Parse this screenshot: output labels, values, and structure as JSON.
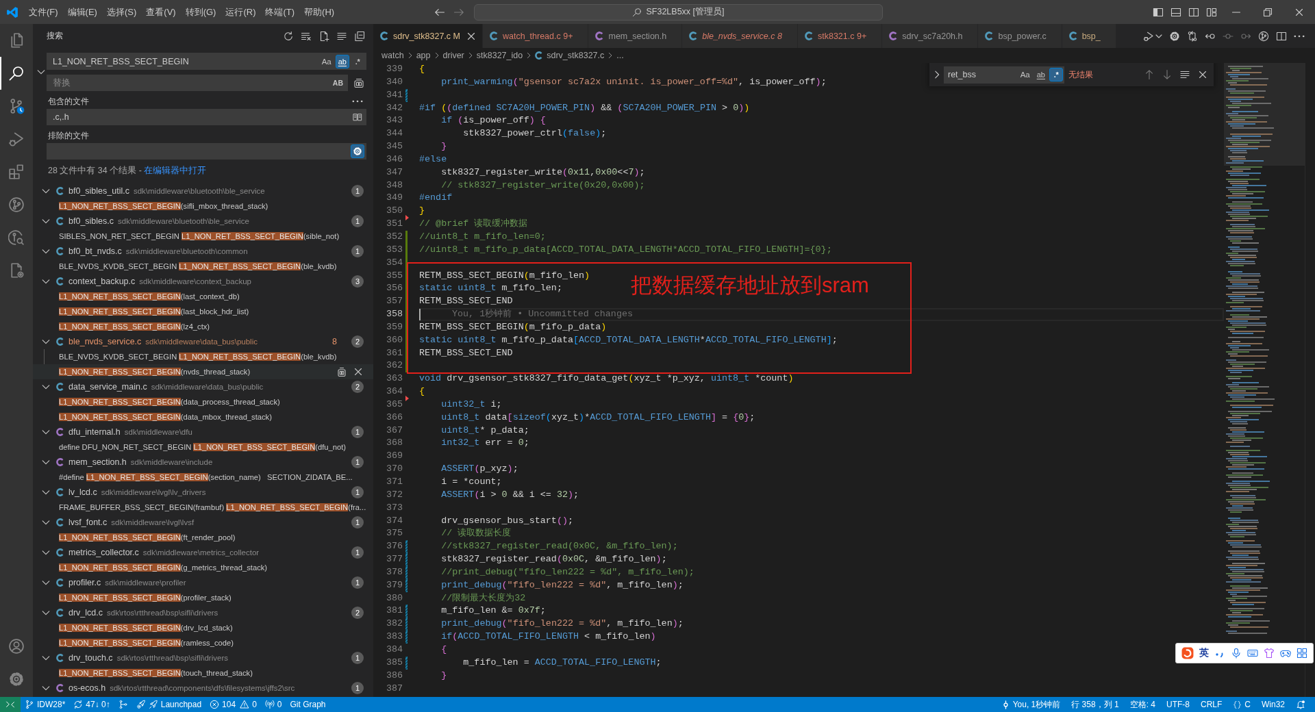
{
  "title_bar": {
    "menu": [
      "文件(F)",
      "编辑(E)",
      "选择(S)",
      "查看(V)",
      "转到(G)",
      "运行(R)",
      "终端(T)",
      "帮助(H)"
    ],
    "command_center": "SF32LB5xx [管理员]"
  },
  "activity_bar": {
    "top": [
      {
        "kind": "explorer",
        "selected": false
      },
      {
        "kind": "search",
        "selected": true
      },
      {
        "kind": "scm",
        "selected": false
      },
      {
        "kind": "debug",
        "selected": false
      },
      {
        "kind": "extensions",
        "selected": false
      },
      {
        "kind": "graph",
        "selected": false
      },
      {
        "kind": "inspect",
        "selected": false
      },
      {
        "kind": "config",
        "selected": false
      }
    ],
    "bottom": [
      {
        "kind": "accounts"
      },
      {
        "kind": "manage"
      }
    ]
  },
  "search_view": {
    "title": "搜索",
    "query": {
      "value": "L1_NON_RET_BSS_SECT_BEGIN",
      "options": [
        {
          "label": "Aa",
          "kind": "case",
          "on": false
        },
        {
          "label": "ab",
          "kind": "word",
          "on": true
        },
        {
          "label": ".*",
          "kind": "regex",
          "on": false
        }
      ]
    },
    "replace_expanded": true,
    "replace": {
      "placeholder": "替换",
      "options": [
        {
          "label": "AB",
          "kind": "preserve",
          "on": false
        }
      ]
    },
    "include": {
      "label": "包含的文件",
      "value": ".c,.h",
      "open_editors_only": false
    },
    "exclude": {
      "label": "排除的文件",
      "use_settings": true
    },
    "summary": "28 文件中有 34 个结果 -",
    "open_in_editor": "在编辑器中打开",
    "results": [
      {
        "file": "bf0_sibles_util.c",
        "kind": "source",
        "path": "sdk\\middleware\\bluetooth\\ble_service",
        "count": "1",
        "expanded": true,
        "matches": [
          {
            "match": "L1_NON_RET_BSS_SECT_BEGIN",
            "after": "(sifli_mbox_thread_stack)",
            "hovered": false
          }
        ]
      },
      {
        "file": "bf0_sibles.c",
        "kind": "source",
        "path": "sdk\\middleware\\bluetooth\\ble_service",
        "count": "1",
        "expanded": true,
        "matches": [
          {
            "before": "SIBLES_NON_RET_SECT_BEGIN ",
            "match": "L1_NON_RET_BSS_SECT_BEGIN",
            "after": "(sible_not)",
            "hovered": false
          }
        ]
      },
      {
        "file": "bf0_bt_nvds.c",
        "kind": "source",
        "path": "sdk\\middleware\\bluetooth\\common",
        "count": "1",
        "expanded": true,
        "matches": [
          {
            "before": "BLE_NVDS_KVDB_SECT_BEGIN ",
            "match": "L1_NON_RET_BSS_SECT_BEGIN",
            "after": "(ble_kvdb)",
            "hovered": false
          }
        ]
      },
      {
        "file": "context_backup.c",
        "kind": "source",
        "path": "sdk\\middleware\\context_backup",
        "count": "3",
        "expanded": true,
        "matches": [
          {
            "match": "L1_NON_RET_BSS_SECT_BEGIN",
            "after": "(last_context_db)",
            "hovered": false
          },
          {
            "match": "L1_NON_RET_BSS_SECT_BEGIN",
            "after": "(last_block_hdr_list)",
            "hovered": false
          },
          {
            "match": "L1_NON_RET_BSS_SECT_BEGIN",
            "after": "(lz4_ctx)",
            "hovered": false
          }
        ]
      },
      {
        "file": "ble_nvds_service.c",
        "kind": "source",
        "path": "sdk\\middleware\\data_bus\\public",
        "problems": "8",
        "count": "2",
        "expanded": true,
        "matches": [
          {
            "before": "BLE_NVDS_KVDB_SECT_BEGIN ",
            "match": "L1_NON_RET_BSS_SECT_BEGIN",
            "after": "(ble_kvdb)",
            "hovered": false
          },
          {
            "match": "L1_NON_RET_BSS_SECT_BEGIN",
            "after": "(nvds_thread_stack)",
            "hovered": true
          }
        ]
      },
      {
        "file": "data_service_main.c",
        "kind": "source",
        "path": "sdk\\middleware\\data_bus\\public",
        "count": "2",
        "expanded": true,
        "matches": [
          {
            "match": "L1_NON_RET_BSS_SECT_BEGIN",
            "after": "(data_process_thread_stack)",
            "hovered": false
          },
          {
            "match": "L1_NON_RET_BSS_SECT_BEGIN",
            "after": "(data_mbox_thread_stack)",
            "hovered": false
          }
        ]
      },
      {
        "file": "dfu_internal.h",
        "kind": "header",
        "path": "sdk\\middleware\\dfu",
        "count": "1",
        "expanded": true,
        "matches": [
          {
            "before": "define DFU_NON_RET_SECT_BEGIN ",
            "match": "L1_NON_RET_BSS_SECT_BEGIN",
            "after": "(dfu_not)",
            "hovered": false
          }
        ]
      },
      {
        "file": "mem_section.h",
        "kind": "header",
        "path": "sdk\\middleware\\include",
        "count": "1",
        "expanded": true,
        "matches": [
          {
            "before": "#define ",
            "match": "L1_NON_RET_BSS_SECT_BEGIN",
            "after": "(section_name)   SECTION_ZIDATA_BE...",
            "hovered": false
          }
        ]
      },
      {
        "file": "lv_lcd.c",
        "kind": "source",
        "path": "sdk\\middleware\\lvgl\\lv_drivers",
        "count": "1",
        "expanded": true,
        "matches": [
          {
            "before": "FRAME_BUFFER_BSS_SECT_BEGIN(frambuf) ",
            "match": "L1_NON_RET_BSS_SECT_BEGIN",
            "after": "(fra...",
            "hovered": false
          }
        ]
      },
      {
        "file": "lvsf_font.c",
        "kind": "source",
        "path": "sdk\\middleware\\lvgl\\lvsf",
        "count": "1",
        "expanded": true,
        "matches": [
          {
            "match": "L1_NON_RET_BSS_SECT_BEGIN",
            "after": "(ft_render_pool)",
            "hovered": false
          }
        ]
      },
      {
        "file": "metrics_collector.c",
        "kind": "source",
        "path": "sdk\\middleware\\metrics_collector",
        "count": "1",
        "expanded": true,
        "matches": [
          {
            "match": "L1_NON_RET_BSS_SECT_BEGIN",
            "after": "(g_metrics_thread_stack)",
            "hovered": false
          }
        ]
      },
      {
        "file": "profiler.c",
        "kind": "source",
        "path": "sdk\\middleware\\profiler",
        "count": "1",
        "expanded": true,
        "matches": [
          {
            "match": "L1_NON_RET_BSS_SECT_BEGIN",
            "after": "(profiler_stack)",
            "hovered": false
          }
        ]
      },
      {
        "file": "drv_lcd.c",
        "kind": "source",
        "path": "sdk\\rtos\\rtthread\\bsp\\sifli\\drivers",
        "count": "2",
        "expanded": true,
        "matches": [
          {
            "match": "L1_NON_RET_BSS_SECT_BEGIN",
            "after": "(drv_lcd_stack)",
            "hovered": false
          },
          {
            "match": "L1_NON_RET_BSS_SECT_BEGIN",
            "after": "(ramless_code)",
            "hovered": false
          }
        ]
      },
      {
        "file": "drv_touch.c",
        "kind": "source",
        "path": "sdk\\rtos\\rtthread\\bsp\\sifli\\drivers",
        "count": "1",
        "expanded": true,
        "matches": [
          {
            "match": "L1_NON_RET_BSS_SECT_BEGIN",
            "after": "(touch_thread_stack)",
            "hovered": false
          }
        ]
      },
      {
        "file": "os-ecos.h",
        "kind": "header",
        "path": "sdk\\rtos\\rtthread\\components\\dfs\\filesystems\\jffs2\\src",
        "count": "1",
        "expanded": true
      }
    ]
  },
  "editor": {
    "tabs": [
      {
        "file": "sdrv_stk8327.c",
        "kind": "source",
        "badge": "M",
        "modified": true,
        "has_errors": false,
        "preview": false,
        "selected": true
      },
      {
        "file": "watch_thread.c",
        "kind": "source",
        "badge": "9+",
        "has_errors": true,
        "preview": false,
        "selected": false
      },
      {
        "file": "mem_section.h",
        "kind": "header",
        "modified": false,
        "has_errors": false,
        "preview": false,
        "selected": false
      },
      {
        "file": "ble_nvds_service.c",
        "kind": "source",
        "badge": "8",
        "has_errors": true,
        "preview": true,
        "selected": false
      },
      {
        "file": "stk8321.c",
        "kind": "source",
        "badge": "9+",
        "has_errors": true,
        "preview": false,
        "selected": false
      },
      {
        "file": "sdrv_sc7a20h.h",
        "kind": "header",
        "modified": false,
        "has_errors": false,
        "preview": false,
        "selected": false
      },
      {
        "file": "bsp_power.c",
        "kind": "source",
        "modified": false,
        "has_errors": false,
        "preview": false,
        "selected": false
      },
      {
        "file": "bsp_",
        "kind": "source",
        "modified": true,
        "has_errors": false,
        "preview": false,
        "selected": false
      }
    ],
    "breadcrumbs": [
      {
        "label": "watch",
        "kind": "folder"
      },
      {
        "label": "app",
        "kind": "folder"
      },
      {
        "label": "driver",
        "kind": "folder"
      },
      {
        "label": "stk8327_ido",
        "kind": "folder"
      },
      {
        "label": "sdrv_stk8327.c",
        "kind": "source"
      },
      {
        "label": "...",
        "kind": "symbol"
      }
    ],
    "lines": [
      {
        "number": "339",
        "kind": "unchanged",
        "current": false,
        "tokens": [
          {
            "text": "{",
            "kind": "bracket1"
          }
        ]
      },
      {
        "number": "340",
        "kind": "unchanged",
        "current": false,
        "tokens": [
          {
            "text": "    print_warming",
            "kind": "macro"
          },
          {
            "text": "(",
            "kind": "bracket2"
          },
          {
            "text": "\"gsensor sc7a2x uninit. is_power_off=%d\"",
            "kind": "string"
          },
          {
            "text": ", is_power_off",
            "kind": "plain"
          },
          {
            "text": ")",
            "kind": "bracket2"
          },
          {
            "text": ";",
            "kind": "plain"
          }
        ]
      },
      {
        "number": "341",
        "kind": "modified",
        "current": false
      },
      {
        "number": "342",
        "kind": "unchanged",
        "current": false,
        "tokens": [
          {
            "text": "#if ",
            "kind": "keyword"
          },
          {
            "text": "(",
            "kind": "bracket1"
          },
          {
            "text": "(",
            "kind": "bracket2"
          },
          {
            "text": "defined ",
            "kind": "keyword"
          },
          {
            "text": "SC7A20H_POWER_PIN",
            "kind": "macro"
          },
          {
            "text": ")",
            "kind": "bracket2"
          },
          {
            "text": " && ",
            "kind": "plain"
          },
          {
            "text": "(",
            "kind": "bracket2"
          },
          {
            "text": "SC7A20H_POWER_PIN",
            "kind": "macro"
          },
          {
            "text": " > ",
            "kind": "plain"
          },
          {
            "text": "0",
            "kind": "number"
          },
          {
            "text": ")",
            "kind": "bracket2"
          },
          {
            "text": ")",
            "kind": "bracket1"
          }
        ]
      },
      {
        "number": "343",
        "kind": "unchanged",
        "current": false,
        "tokens": [
          {
            "text": "    if ",
            "kind": "keyword"
          },
          {
            "text": "(",
            "kind": "bracket2"
          },
          {
            "text": "is_power_off",
            "kind": "plain"
          },
          {
            "text": ")",
            "kind": "bracket2"
          },
          {
            "text": " {",
            "kind": "bracket2"
          }
        ]
      },
      {
        "number": "344",
        "kind": "unchanged",
        "current": false,
        "tokens": [
          {
            "text": "        stk8327_power_ctrl",
            "kind": "plain"
          },
          {
            "text": "(",
            "kind": "bracket3"
          },
          {
            "text": "false",
            "kind": "keyword"
          },
          {
            "text": ")",
            "kind": "bracket3"
          },
          {
            "text": ";",
            "kind": "plain"
          }
        ]
      },
      {
        "number": "345",
        "kind": "unchanged",
        "current": false,
        "tokens": [
          {
            "text": "    }",
            "kind": "bracket2"
          }
        ]
      },
      {
        "number": "346",
        "kind": "unchanged",
        "current": false,
        "tokens": [
          {
            "text": "#else",
            "kind": "keyword"
          }
        ]
      },
      {
        "number": "347",
        "kind": "unchanged",
        "current": false,
        "tokens": [
          {
            "text": "    stk8327_register_write",
            "kind": "plain"
          },
          {
            "text": "(",
            "kind": "bracket2"
          },
          {
            "text": "0x11",
            "kind": "number"
          },
          {
            "text": ",",
            "kind": "plain"
          },
          {
            "text": "0x00",
            "kind": "number"
          },
          {
            "text": "<<",
            "kind": "plain"
          },
          {
            "text": "7",
            "kind": "number"
          },
          {
            "text": ")",
            "kind": "bracket2"
          },
          {
            "text": ";",
            "kind": "plain"
          }
        ]
      },
      {
        "number": "348",
        "kind": "unchanged",
        "current": false,
        "tokens": [
          {
            "text": "    // stk8327_register_write(0x20,0x00);",
            "kind": "comment"
          }
        ]
      },
      {
        "number": "349",
        "kind": "unchanged",
        "current": false,
        "tokens": [
          {
            "text": "#endif",
            "kind": "keyword"
          }
        ]
      },
      {
        "number": "350",
        "kind": "deleted",
        "current": false,
        "tokens": [
          {
            "text": "}",
            "kind": "bracket1"
          }
        ]
      },
      {
        "number": "351",
        "kind": "unchanged",
        "current": false,
        "tokens": [
          {
            "text": "// @brief 读取缓冲数据",
            "kind": "comment"
          }
        ]
      },
      {
        "number": "352",
        "kind": "added",
        "current": false,
        "tokens": [
          {
            "text": "//uint8_t m_fifo_len=0;",
            "kind": "comment"
          }
        ]
      },
      {
        "number": "353",
        "kind": "added",
        "current": false,
        "tokens": [
          {
            "text": "//uint8_t m_fifo_p_data[ACCD_TOTAL_DATA_LENGTH*ACCD_TOTAL_FIFO_LENGTH]={0};",
            "kind": "comment"
          }
        ]
      },
      {
        "number": "354",
        "kind": "added",
        "current": false
      },
      {
        "number": "355",
        "kind": "added",
        "current": false,
        "tokens": [
          {
            "text": "RETM_BSS_SECT_BEGIN",
            "kind": "plain"
          },
          {
            "text": "(",
            "kind": "bracket1"
          },
          {
            "text": "m_fifo_len",
            "kind": "plain"
          },
          {
            "text": ")",
            "kind": "bracket1"
          }
        ]
      },
      {
        "number": "356",
        "kind": "added",
        "current": false,
        "tokens": [
          {
            "text": "static uint8_t",
            "kind": "keyword"
          },
          {
            "text": " m_fifo_len;",
            "kind": "plain"
          }
        ]
      },
      {
        "number": "357",
        "kind": "added",
        "current": false,
        "tokens": [
          {
            "text": "RETM_BSS_SECT_END",
            "kind": "plain"
          }
        ]
      },
      {
        "number": "358",
        "kind": "added",
        "current": true,
        "blame": "You, 1秒钟前 • Uncommitted changes"
      },
      {
        "number": "359",
        "kind": "added",
        "current": false,
        "tokens": [
          {
            "text": "RETM_BSS_SECT_BEGIN",
            "kind": "plain"
          },
          {
            "text": "(",
            "kind": "bracket1"
          },
          {
            "text": "m_fifo_p_data",
            "kind": "plain"
          },
          {
            "text": ")",
            "kind": "bracket1"
          }
        ]
      },
      {
        "number": "360",
        "kind": "added",
        "current": false,
        "tokens": [
          {
            "text": "static uint8_t",
            "kind": "keyword"
          },
          {
            "text": " m_fifo_p_data",
            "kind": "plain"
          },
          {
            "text": "[",
            "kind": "bracket3"
          },
          {
            "text": "ACCD_TOTAL_DATA_LENGTH",
            "kind": "macro"
          },
          {
            "text": "*",
            "kind": "plain"
          },
          {
            "text": "ACCD_TOTAL_FIFO_LENGTH",
            "kind": "macro"
          },
          {
            "text": "]",
            "kind": "bracket3"
          },
          {
            "text": ";",
            "kind": "plain"
          }
        ]
      },
      {
        "number": "361",
        "kind": "added",
        "current": false,
        "tokens": [
          {
            "text": "RETM_BSS_SECT_END",
            "kind": "plain"
          }
        ]
      },
      {
        "number": "362",
        "kind": "added",
        "current": false
      },
      {
        "number": "363",
        "kind": "unchanged",
        "current": false,
        "tokens": [
          {
            "text": "void",
            "kind": "keyword"
          },
          {
            "text": " drv_gsensor_stk8327_fifo_data_get",
            "kind": "plain"
          },
          {
            "text": "(",
            "kind": "bracket1"
          },
          {
            "text": "xyz_t *p_xyz, ",
            "kind": "plain"
          },
          {
            "text": "uint8_t",
            "kind": "keyword"
          },
          {
            "text": " *count",
            "kind": "plain"
          },
          {
            "text": ")",
            "kind": "bracket1"
          }
        ]
      },
      {
        "number": "364",
        "kind": "deleted",
        "current": false,
        "tokens": [
          {
            "text": "{",
            "kind": "bracket1"
          }
        ]
      },
      {
        "number": "365",
        "kind": "unchanged",
        "current": false,
        "tokens": [
          {
            "text": "    uint32_t",
            "kind": "keyword"
          },
          {
            "text": " i;",
            "kind": "plain"
          }
        ]
      },
      {
        "number": "366",
        "kind": "unchanged",
        "current": false,
        "tokens": [
          {
            "text": "    uint8_t",
            "kind": "keyword"
          },
          {
            "text": " data",
            "kind": "plain"
          },
          {
            "text": "[",
            "kind": "bracket2"
          },
          {
            "text": "sizeof",
            "kind": "keyword"
          },
          {
            "text": "(",
            "kind": "bracket3"
          },
          {
            "text": "xyz_t",
            "kind": "plain"
          },
          {
            "text": ")",
            "kind": "bracket3"
          },
          {
            "text": "*",
            "kind": "plain"
          },
          {
            "text": "ACCD_TOTAL_FIFO_LENGTH",
            "kind": "macro"
          },
          {
            "text": "]",
            "kind": "bracket2"
          },
          {
            "text": " = ",
            "kind": "plain"
          },
          {
            "text": "{",
            "kind": "bracket2"
          },
          {
            "text": "0",
            "kind": "number"
          },
          {
            "text": "}",
            "kind": "bracket2"
          },
          {
            "text": ";",
            "kind": "plain"
          }
        ]
      },
      {
        "number": "367",
        "kind": "unchanged",
        "current": false,
        "tokens": [
          {
            "text": "    uint8_t",
            "kind": "keyword"
          },
          {
            "text": "* p_data;",
            "kind": "plain"
          }
        ]
      },
      {
        "number": "368",
        "kind": "unchanged",
        "current": false,
        "tokens": [
          {
            "text": "    int32_t",
            "kind": "keyword"
          },
          {
            "text": " err = ",
            "kind": "plain"
          },
          {
            "text": "0",
            "kind": "number"
          },
          {
            "text": ";",
            "kind": "plain"
          }
        ]
      },
      {
        "number": "369",
        "kind": "unchanged",
        "current": false
      },
      {
        "number": "370",
        "kind": "unchanged",
        "current": false,
        "tokens": [
          {
            "text": "    ASSERT",
            "kind": "macro"
          },
          {
            "text": "(",
            "kind": "bracket2"
          },
          {
            "text": "p_xyz",
            "kind": "plain"
          },
          {
            "text": ")",
            "kind": "bracket2"
          },
          {
            "text": ";",
            "kind": "plain"
          }
        ]
      },
      {
        "number": "371",
        "kind": "unchanged",
        "current": false,
        "tokens": [
          {
            "text": "    i = *count;",
            "kind": "plain"
          }
        ]
      },
      {
        "number": "372",
        "kind": "unchanged",
        "current": false,
        "tokens": [
          {
            "text": "    ASSERT",
            "kind": "macro"
          },
          {
            "text": "(",
            "kind": "bracket2"
          },
          {
            "text": "i > ",
            "kind": "plain"
          },
          {
            "text": "0",
            "kind": "number"
          },
          {
            "text": " && i <= ",
            "kind": "plain"
          },
          {
            "text": "32",
            "kind": "number"
          },
          {
            "text": ")",
            "kind": "bracket2"
          },
          {
            "text": ";",
            "kind": "plain"
          }
        ]
      },
      {
        "number": "373",
        "kind": "unchanged",
        "current": false
      },
      {
        "number": "374",
        "kind": "unchanged",
        "current": false,
        "tokens": [
          {
            "text": "    drv_gsensor_bus_start",
            "kind": "plain"
          },
          {
            "text": "(",
            "kind": "bracket2"
          },
          {
            "text": ")",
            "kind": "bracket2"
          },
          {
            "text": ";",
            "kind": "plain"
          }
        ]
      },
      {
        "number": "375",
        "kind": "unchanged",
        "current": false,
        "tokens": [
          {
            "text": "    // 读取数据长度",
            "kind": "comment"
          }
        ]
      },
      {
        "number": "376",
        "kind": "modified",
        "current": false,
        "tokens": [
          {
            "text": "    //stk8327_register_read(0x0C, &m_fifo_len);",
            "kind": "comment"
          }
        ]
      },
      {
        "number": "377",
        "kind": "modified",
        "current": false,
        "tokens": [
          {
            "text": "    stk8327_register_read",
            "kind": "plain"
          },
          {
            "text": "(",
            "kind": "bracket2"
          },
          {
            "text": "0x0C",
            "kind": "number"
          },
          {
            "text": ", &m_fifo_len",
            "kind": "plain"
          },
          {
            "text": ")",
            "kind": "bracket2"
          },
          {
            "text": ";",
            "kind": "plain"
          }
        ]
      },
      {
        "number": "378",
        "kind": "modified",
        "current": false,
        "tokens": [
          {
            "text": "    //print_debug(\"fifo_len222 = %d\", m_fifo_len);",
            "kind": "comment"
          }
        ]
      },
      {
        "number": "379",
        "kind": "modified",
        "current": false,
        "tokens": [
          {
            "text": "    print_debug",
            "kind": "macro"
          },
          {
            "text": "(",
            "kind": "bracket2"
          },
          {
            "text": "\"fifo_len222 = %d\"",
            "kind": "string"
          },
          {
            "text": ", m_fifo_len",
            "kind": "plain"
          },
          {
            "text": ")",
            "kind": "bracket2"
          },
          {
            "text": ";",
            "kind": "plain"
          }
        ]
      },
      {
        "number": "380",
        "kind": "unchanged",
        "current": false,
        "tokens": [
          {
            "text": "    //限制最大长度为32",
            "kind": "comment"
          }
        ]
      },
      {
        "number": "381",
        "kind": "modified",
        "current": false,
        "tokens": [
          {
            "text": "    m_fifo_len &= ",
            "kind": "plain"
          },
          {
            "text": "0x7f",
            "kind": "number"
          },
          {
            "text": ";",
            "kind": "plain"
          }
        ]
      },
      {
        "number": "382",
        "kind": "modified",
        "current": false,
        "tokens": [
          {
            "text": "    print_debug",
            "kind": "macro"
          },
          {
            "text": "(",
            "kind": "bracket2"
          },
          {
            "text": "\"fifo_len222 = %d\"",
            "kind": "string"
          },
          {
            "text": ", m_fifo_len",
            "kind": "plain"
          },
          {
            "text": ")",
            "kind": "bracket2"
          },
          {
            "text": ";",
            "kind": "plain"
          }
        ]
      },
      {
        "number": "383",
        "kind": "modified",
        "current": false,
        "tokens": [
          {
            "text": "    if",
            "kind": "keyword"
          },
          {
            "text": "(",
            "kind": "bracket2"
          },
          {
            "text": "ACCD_TOTAL_FIFO_LENGTH",
            "kind": "macro"
          },
          {
            "text": " < m_fifo_len",
            "kind": "plain"
          },
          {
            "text": ")",
            "kind": "bracket2"
          }
        ]
      },
      {
        "number": "384",
        "kind": "unchanged",
        "current": false,
        "tokens": [
          {
            "text": "    {",
            "kind": "bracket2"
          }
        ]
      },
      {
        "number": "385",
        "kind": "modified",
        "current": false,
        "tokens": [
          {
            "text": "        m_fifo_len = ",
            "kind": "plain"
          },
          {
            "text": "ACCD_TOTAL_FIFO_LENGTH",
            "kind": "macro"
          },
          {
            "text": ";",
            "kind": "plain"
          }
        ]
      },
      {
        "number": "386",
        "kind": "unchanged",
        "current": false,
        "tokens": [
          {
            "text": "    }",
            "kind": "bracket2"
          }
        ]
      },
      {
        "number": "387",
        "kind": "unchanged",
        "current": false
      }
    ],
    "find_widget": {
      "replace_expanded": false,
      "value": "ret_bss",
      "options": [
        {
          "label": "Aa",
          "kind": "case",
          "on": false
        },
        {
          "label": "ab",
          "kind": "word",
          "on": false
        },
        {
          "label": ".*",
          "kind": "regex",
          "on": true
        }
      ],
      "message": "无结果"
    },
    "annotation": {
      "text": "把数据缓存地址放到sram"
    }
  },
  "status_bar": {
    "left": [
      {
        "kind": "remote"
      },
      {
        "kind": "branch",
        "text": "IDW28*"
      },
      {
        "kind": "sync",
        "text": "47↓ 0↑"
      },
      {
        "kind": "gitlens"
      },
      {
        "kind": "launchpad",
        "text": "Launchpad"
      },
      {
        "kind": "problems",
        "errors": "104",
        "warnings": "0"
      },
      {
        "kind": "ports",
        "text": "0"
      },
      {
        "kind": "plain",
        "text": "Git Graph"
      }
    ],
    "right": [
      {
        "kind": "blame",
        "text": "You, 1秒钟前"
      },
      {
        "kind": "plain",
        "text": "行 358，列 1"
      },
      {
        "kind": "plain",
        "text": "空格: 4"
      },
      {
        "kind": "plain",
        "text": "UTF-8"
      },
      {
        "kind": "plain",
        "text": "CRLF"
      },
      {
        "kind": "language",
        "text": "C"
      },
      {
        "kind": "plain",
        "text": "Win32"
      },
      {
        "kind": "notifications"
      }
    ]
  },
  "ime_toolbar": {
    "mode": "英"
  }
}
